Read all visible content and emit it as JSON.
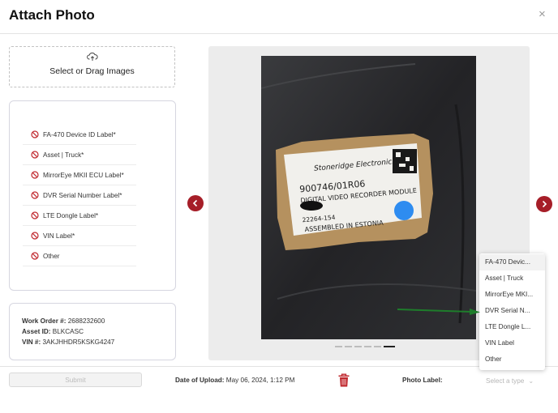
{
  "dialog": {
    "title": "Attach Photo",
    "close": "×"
  },
  "dropzone": {
    "label": "Select or Drag Images"
  },
  "required_labels": [
    "FA-470 Device ID Label*",
    "Asset | Truck*",
    "MirrorEye MKII ECU Label*",
    "DVR Serial Number Label*",
    "LTE Dongle Label*",
    "VIN Label*",
    "Other"
  ],
  "work_info": {
    "work_order_label": "Work Order #:",
    "work_order_value": "2688232600",
    "asset_label": "Asset ID:",
    "asset_value": "BLKCASC",
    "vin_label": "VIN #:",
    "vin_value": "3AKJHHDR5KSKG4247"
  },
  "photo_label_text": {
    "brand": "Stoneridge Electronics",
    "part": "900746/01R06",
    "desc": "DIGITAL VIDEO RECORDER MODULE",
    "code": "22264-154",
    "origin": "ASSEMBLED IN ESTONIA"
  },
  "carousel": {
    "total": 6,
    "active": 6
  },
  "footer": {
    "submit": "Submit",
    "upload_label": "Date of Upload:",
    "upload_value": "May 06, 2024, 1:12 PM",
    "photo_label": "Photo Label:",
    "select_placeholder": "Select a type"
  },
  "dropdown_options": [
    "FA-470 Devic...",
    "Asset | Truck",
    "MirrorEye MKI...",
    "DVR Serial N...",
    "LTE Dongle L...",
    "VIN Label",
    "Other"
  ],
  "colors": {
    "accent": "#a61e28",
    "ban_icon": "#c0282e",
    "arrow": "#1e7d2b",
    "blue_dot": "#2e8cf0"
  }
}
